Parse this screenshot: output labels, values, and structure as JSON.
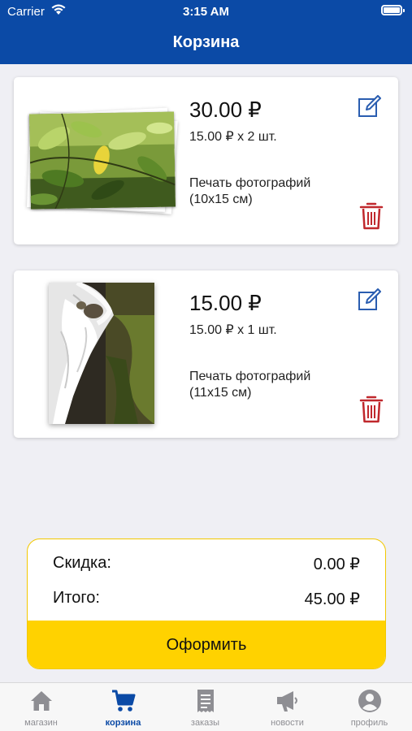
{
  "status_bar": {
    "carrier": "Carrier",
    "time": "3:15 AM"
  },
  "header": {
    "title": "Корзина"
  },
  "cart": {
    "items": [
      {
        "price": "30.00 ₽",
        "unit": "15.00 ₽ х 2 шт.",
        "desc_line1": "Печать фотографий",
        "desc_line2": "(10x15 см)",
        "edit_icon": "edit-icon",
        "delete_icon": "trash-icon"
      },
      {
        "price": "15.00 ₽",
        "unit": "15.00 ₽ х 1 шт.",
        "desc_line1": "Печать фотографий",
        "desc_line2": "(11x15 см)",
        "edit_icon": "edit-icon",
        "delete_icon": "trash-icon"
      }
    ]
  },
  "summary": {
    "discount_label": "Скидка:",
    "discount_value": "0.00 ₽",
    "total_label": "Итого:",
    "total_value": "45.00 ₽",
    "checkout_label": "Оформить"
  },
  "tabbar": {
    "items": [
      {
        "label": "магазин",
        "icon": "home-icon"
      },
      {
        "label": "корзина",
        "icon": "cart-icon",
        "active": true
      },
      {
        "label": "заказы",
        "icon": "receipt-icon"
      },
      {
        "label": "новости",
        "icon": "megaphone-icon"
      },
      {
        "label": "профиль",
        "icon": "profile-icon"
      }
    ]
  },
  "colors": {
    "primary": "#0b4aa6",
    "accent": "#ffd200",
    "danger": "#c0282d",
    "tab_inactive": "#8e8e93"
  }
}
